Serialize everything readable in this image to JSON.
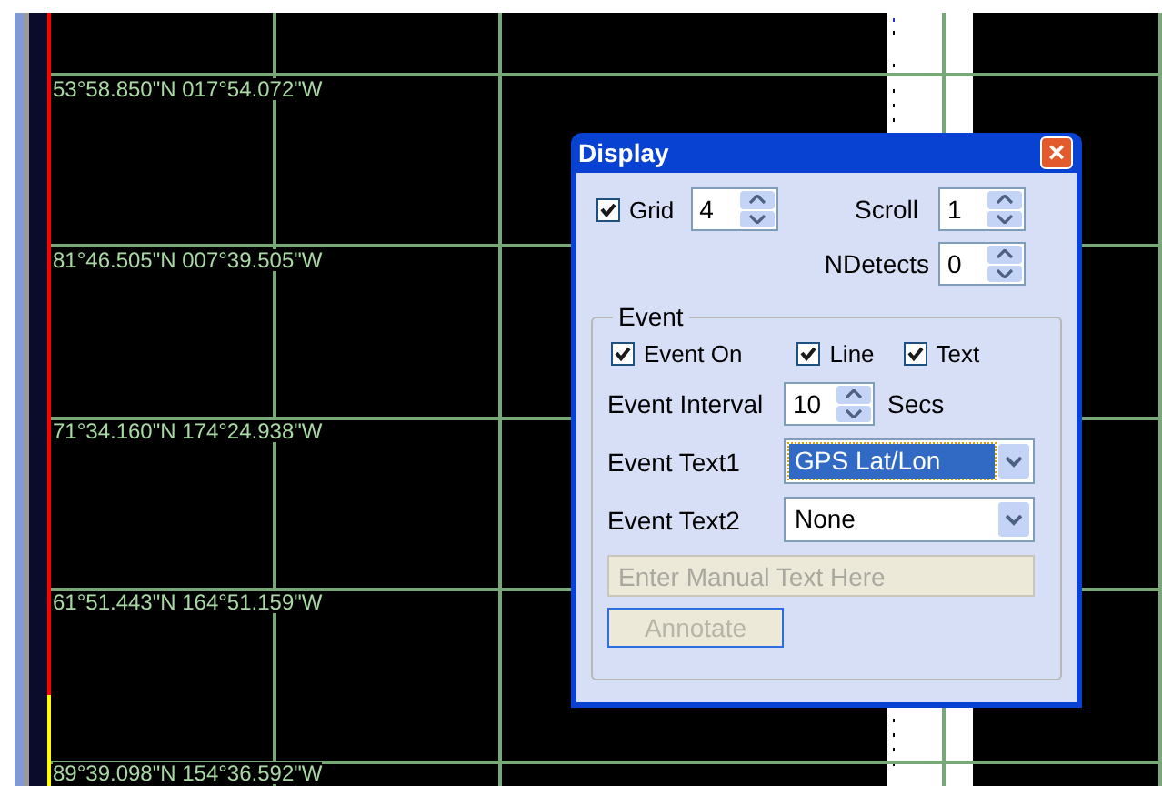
{
  "map": {
    "labels": [
      "53°58.850\"N 017°54.072\"W",
      "81°46.505\"N 007°39.505\"W",
      "71°34.160\"N 174°24.938\"W",
      "61°51.443\"N 164°51.159\"W",
      "89°39.098\"N 154°36.592\"W"
    ]
  },
  "dialog": {
    "title": "Display",
    "close": "×",
    "grid": {
      "label": "Grid",
      "checked": true,
      "value": "4"
    },
    "scroll": {
      "label": "Scroll",
      "value": "1"
    },
    "ndetects": {
      "label": "NDetects",
      "value": "0"
    },
    "event": {
      "legend": "Event",
      "checks": [
        {
          "label": "Event On",
          "checked": true
        },
        {
          "label": "Line",
          "checked": true
        },
        {
          "label": "Text",
          "checked": true
        }
      ],
      "interval": {
        "label": "Event Interval",
        "value": "10",
        "unit": "Secs"
      },
      "text1": {
        "label": "Event Text1",
        "value": "GPS Lat/Lon",
        "focused": true
      },
      "text2": {
        "label": "Event Text2",
        "value": "None",
        "focused": false
      },
      "manual": {
        "placeholder": "Enter Manual Text Here",
        "disabled": true
      },
      "annotate": {
        "label": "Annotate",
        "disabled": true
      }
    }
  }
}
